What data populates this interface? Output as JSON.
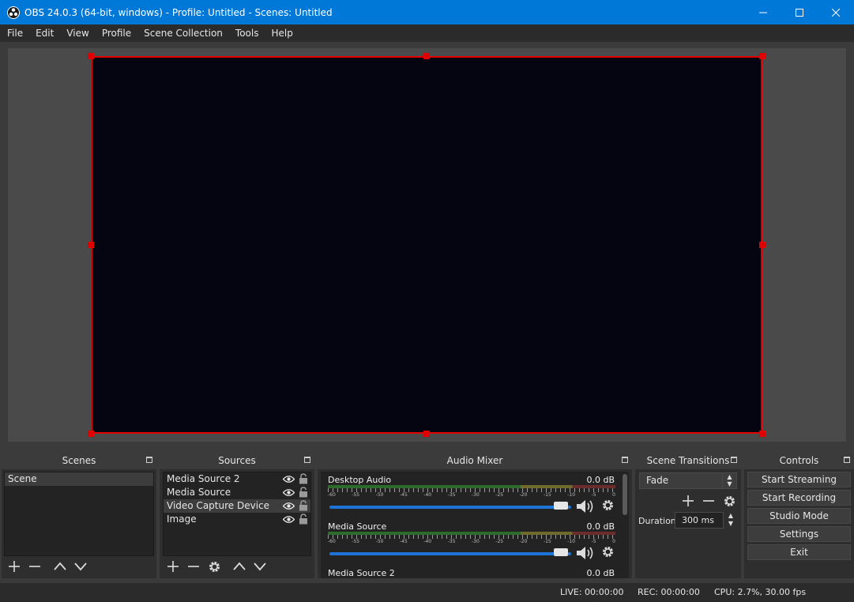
{
  "window": {
    "title": "OBS 24.0.3 (64-bit, windows) - Profile: Untitled - Scenes: Untitled",
    "accent": "#0078d7"
  },
  "menu": [
    "File",
    "Edit",
    "View",
    "Profile",
    "Scene Collection",
    "Tools",
    "Help"
  ],
  "preview": {
    "selection_color": "#e00000",
    "canvas_color": "#050512"
  },
  "scenes": {
    "title": "Scenes",
    "items": [
      "Scene"
    ]
  },
  "sources": {
    "title": "Sources",
    "items": [
      "Media Source 2",
      "Media Source",
      "Video Capture Device",
      "Image"
    ]
  },
  "mixer": {
    "title": "Audio Mixer",
    "scale": [
      "-60",
      "-55",
      "-50",
      "-45",
      "-40",
      "-35",
      "-30",
      "-25",
      "-20",
      "-15",
      "-10",
      "-5",
      "0"
    ],
    "channels": [
      {
        "name": "Desktop Audio",
        "db": "0.0 dB",
        "volume": 1.0
      },
      {
        "name": "Media Source",
        "db": "0.0 dB",
        "volume": 1.0
      },
      {
        "name": "Media Source 2",
        "db": "0.0 dB",
        "volume": 1.0
      }
    ]
  },
  "transitions": {
    "title": "Scene Transitions",
    "selected": "Fade",
    "duration_label": "Duration",
    "duration_value": "300 ms"
  },
  "controls": {
    "title": "Controls",
    "buttons": [
      "Start Streaming",
      "Start Recording",
      "Studio Mode",
      "Settings",
      "Exit"
    ]
  },
  "status": {
    "live": "LIVE: 00:00:00",
    "rec": "REC: 00:00:00",
    "cpu": "CPU: 2.7%, 30.00 fps"
  },
  "icons": {
    "add": "plus-icon",
    "remove": "minus-icon",
    "up": "chevron-up-icon",
    "down": "chevron-down-icon",
    "settings": "gear-icon",
    "visibility": "eye-icon",
    "lock": "lock-icon",
    "mute": "speaker-icon"
  }
}
